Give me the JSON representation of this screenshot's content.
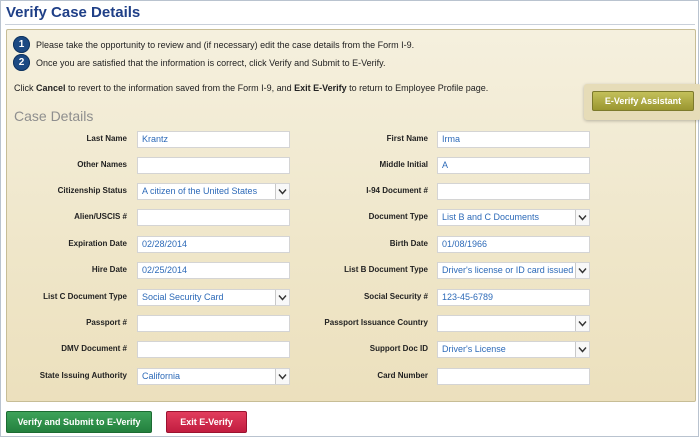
{
  "page": {
    "title": "Verify Case Details"
  },
  "steps": [
    {
      "number": "1",
      "text": "Please take the opportunity to review and (if necessary) edit the case details from the Form I-9."
    },
    {
      "number": "2",
      "text": "Once you are satisfied that the information is correct, click Verify and Submit to E-Verify."
    }
  ],
  "note": {
    "prefix": "Click ",
    "cancel": "Cancel",
    "middle": " to revert to the information saved from the Form I-9, and ",
    "exit": "Exit E-Verify",
    "suffix": " to return to Employee Profile page."
  },
  "assistant_button": "E-Verify Assistant",
  "section_title": "Case Details",
  "fields": {
    "last_name": {
      "label": "Last Name",
      "value": "Krantz"
    },
    "first_name": {
      "label": "First Name",
      "value": "Irma"
    },
    "other_names": {
      "label": "Other Names",
      "value": ""
    },
    "middle_initial": {
      "label": "Middle Initial",
      "value": "A"
    },
    "citizenship_status": {
      "label": "Citizenship Status",
      "value": "A citizen of the United States"
    },
    "i94_document": {
      "label": "I-94 Document #",
      "value": ""
    },
    "alien_uscis": {
      "label": "Alien/USCIS #",
      "value": ""
    },
    "document_type": {
      "label": "Document Type",
      "value": "List B and C Documents"
    },
    "expiration_date": {
      "label": "Expiration Date",
      "value": "02/28/2014"
    },
    "birth_date": {
      "label": "Birth Date",
      "value": "01/08/1966"
    },
    "hire_date": {
      "label": "Hire Date",
      "value": "02/25/2014"
    },
    "list_b_document_type": {
      "label": "List B Document Type",
      "value": "Driver's license or ID card issued"
    },
    "list_c_document_type": {
      "label": "List C Document Type",
      "value": "Social Security Card"
    },
    "social_security": {
      "label": "Social Security #",
      "value": "123-45-6789"
    },
    "passport": {
      "label": "Passport #",
      "value": ""
    },
    "passport_country": {
      "label": "Passport Issuance Country",
      "value": ""
    },
    "dmv_document": {
      "label": "DMV Document #",
      "value": ""
    },
    "support_doc_id": {
      "label": "Support Doc ID",
      "value": "Driver's License"
    },
    "state_issuing_authority": {
      "label": "State Issuing Authority",
      "value": "California"
    },
    "card_number": {
      "label": "Card Number",
      "value": ""
    }
  },
  "buttons": {
    "verify": "Verify and Submit to E-Verify",
    "exit": "Exit E-Verify"
  },
  "colors": {
    "title": "#1f3f87",
    "step_badge": "#1c4a83",
    "panel_bg": "#efe6c9",
    "value_text": "#2d6ab8",
    "verify_button": "#2f9148",
    "exit_button": "#d42d50",
    "assistant_button": "#aeab40"
  }
}
